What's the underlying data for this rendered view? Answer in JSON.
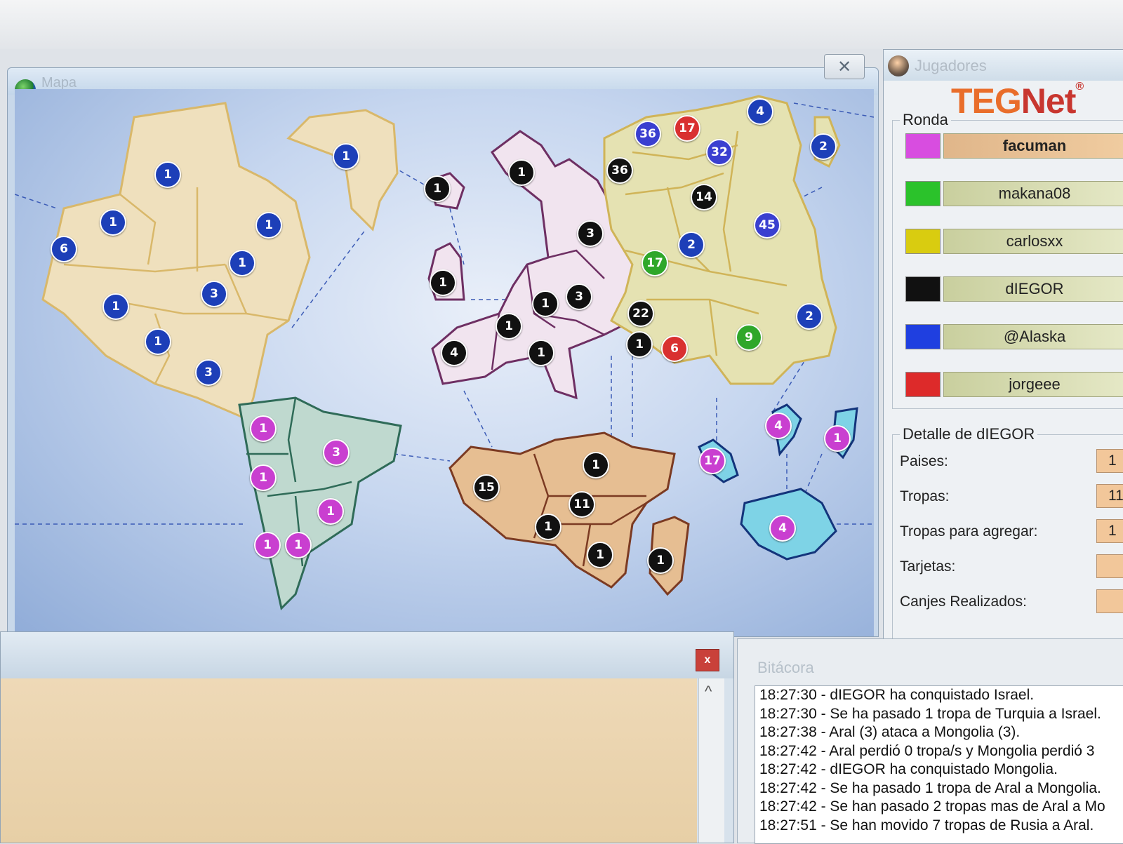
{
  "map_window": {
    "title": "Mapa",
    "close_label": "✕",
    "bubbles": [
      {
        "v": "1",
        "c": "#1d3fb8"
      },
      {
        "v": "1",
        "c": "#1d3fb8"
      },
      {
        "v": "6",
        "c": "#1d3fb8"
      },
      {
        "v": "1",
        "c": "#1d3fb8"
      },
      {
        "v": "1",
        "c": "#1d3fb8"
      },
      {
        "v": "1",
        "c": "#1d3fb8"
      },
      {
        "v": "3",
        "c": "#1d3fb8"
      },
      {
        "v": "1",
        "c": "#1d3fb8"
      },
      {
        "v": "1",
        "c": "#1d3fb8"
      },
      {
        "v": "3",
        "c": "#1d3fb8"
      },
      {
        "v": "1",
        "c": "#1d3fb8"
      },
      {
        "v": "1",
        "c": "#111111"
      },
      {
        "v": "1",
        "c": "#111111"
      },
      {
        "v": "3",
        "c": "#111111"
      },
      {
        "v": "1",
        "c": "#111111"
      },
      {
        "v": "1",
        "c": "#111111"
      },
      {
        "v": "3",
        "c": "#111111"
      },
      {
        "v": "1",
        "c": "#111111"
      },
      {
        "v": "4",
        "c": "#111111"
      },
      {
        "v": "1",
        "c": "#111111"
      },
      {
        "v": "36",
        "c": "#3a3fd0"
      },
      {
        "v": "17",
        "c": "#d93030"
      },
      {
        "v": "4",
        "c": "#1d3fb8"
      },
      {
        "v": "32",
        "c": "#3a3fd0"
      },
      {
        "v": "2",
        "c": "#1d3fb8"
      },
      {
        "v": "36",
        "c": "#111111"
      },
      {
        "v": "14",
        "c": "#111111"
      },
      {
        "v": "45",
        "c": "#3a3fd0"
      },
      {
        "v": "2",
        "c": "#1d3fb8"
      },
      {
        "v": "17",
        "c": "#2fa72a"
      },
      {
        "v": "22",
        "c": "#111111"
      },
      {
        "v": "2",
        "c": "#1d3fb8"
      },
      {
        "v": "1",
        "c": "#111111"
      },
      {
        "v": "6",
        "c": "#d93030"
      },
      {
        "v": "9",
        "c": "#2fa72a"
      },
      {
        "v": "1",
        "c": "#c93fd0"
      },
      {
        "v": "3",
        "c": "#c93fd0"
      },
      {
        "v": "1",
        "c": "#c93fd0"
      },
      {
        "v": "1",
        "c": "#c93fd0"
      },
      {
        "v": "1",
        "c": "#c93fd0"
      },
      {
        "v": "1",
        "c": "#c93fd0"
      },
      {
        "v": "15",
        "c": "#111111"
      },
      {
        "v": "1",
        "c": "#111111"
      },
      {
        "v": "11",
        "c": "#111111"
      },
      {
        "v": "1",
        "c": "#111111"
      },
      {
        "v": "1",
        "c": "#111111"
      },
      {
        "v": "1",
        "c": "#111111"
      },
      {
        "v": "17",
        "c": "#c93fd0"
      },
      {
        "v": "4",
        "c": "#c93fd0"
      },
      {
        "v": "1",
        "c": "#c93fd0"
      },
      {
        "v": "4",
        "c": "#c93fd0"
      }
    ]
  },
  "players_window": {
    "title": "Jugadores",
    "logo_teg": "TEG",
    "logo_net": "Net",
    "logo_reg": "®",
    "ronda_label": "Ronda",
    "players": [
      {
        "name": "facuman",
        "color": "#d84de0",
        "active": true
      },
      {
        "name": "makana08",
        "color": "#2bc22b",
        "active": false
      },
      {
        "name": "carlosxx",
        "color": "#d9cc10",
        "active": false
      },
      {
        "name": "dIEGOR",
        "color": "#111111",
        "active": false
      },
      {
        "name": "@Alaska",
        "color": "#1f3fe0",
        "active": false
      },
      {
        "name": "jorgeee",
        "color": "#dd2a2a",
        "active": false
      }
    ],
    "detalle_label": "Detalle de dIEGOR",
    "stats": [
      {
        "label": "Paises:",
        "value": "1"
      },
      {
        "label": "Tropas:",
        "value": "11"
      },
      {
        "label": "Tropas para agregar:",
        "value": "1"
      },
      {
        "label": "Tarjetas:",
        "value": ""
      },
      {
        "label": "Canjes Realizados:",
        "value": ""
      }
    ]
  },
  "chat_window": {
    "close_label": "x",
    "scroll_up": "^"
  },
  "log_window": {
    "title": "Bitácora",
    "lines": [
      "18:27:30 - dIEGOR ha conquistado Israel.",
      "18:27:30 - Se ha pasado 1 tropa de Turquia a Israel.",
      "18:27:38 - Aral (3) ataca a Mongolia (3).",
      "18:27:42 - Aral perdió 0 tropa/s y Mongolia perdió 3",
      "18:27:42 - dIEGOR ha conquistado Mongolia.",
      "18:27:42 - Se ha pasado 1 tropa de Aral a Mongolia.",
      "18:27:42 - Se han pasado 2 tropas mas de Aral a Mo",
      "18:27:51 - Se han movido 7 tropas de Rusia a Aral."
    ]
  }
}
